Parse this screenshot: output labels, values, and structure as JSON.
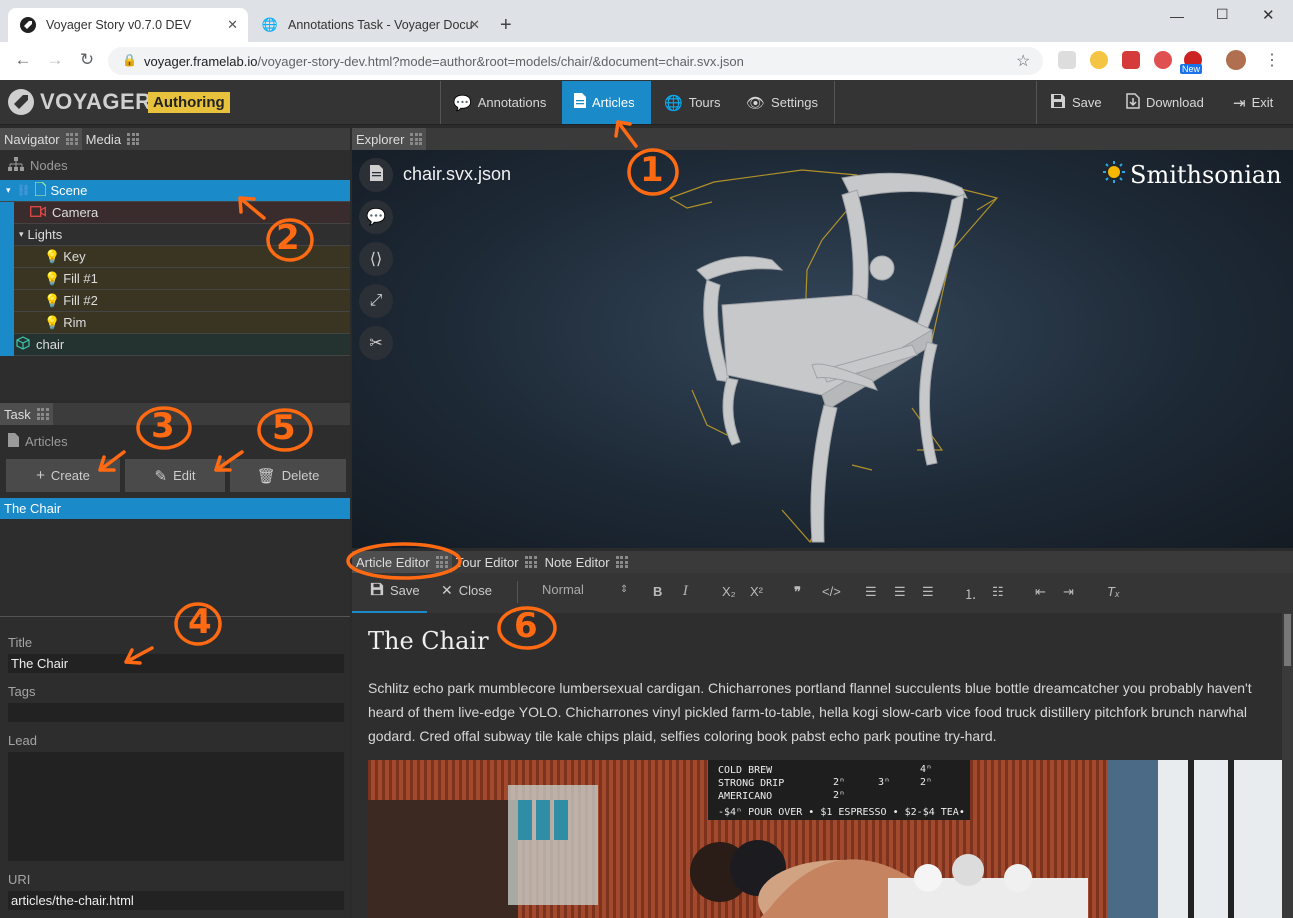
{
  "browser": {
    "tabs": [
      {
        "title": "Voyager Story v0.7.0 DEV",
        "active": true
      },
      {
        "title": "Annotations Task - Voyager Docu",
        "active": false
      }
    ],
    "url_host": "voyager.framelab.io",
    "url_path": "/voyager-story-dev.html?mode=author&root=models/chair/&document=chair.svx.json",
    "ext_new_badge": "New"
  },
  "header": {
    "logo": "VOYAGER",
    "badge": "Authoring",
    "modes": [
      {
        "label": "Annotations",
        "icon": "comment-icon"
      },
      {
        "label": "Articles",
        "icon": "document-icon",
        "active": true
      },
      {
        "label": "Tours",
        "icon": "globe-icon"
      },
      {
        "label": "Settings",
        "icon": "eye-icon"
      }
    ],
    "actions": {
      "save": "Save",
      "download": "Download",
      "exit": "Exit"
    }
  },
  "navigator": {
    "tabs": [
      "Navigator",
      "Media"
    ],
    "section": "Nodes",
    "nodes": [
      {
        "label": "Scene",
        "selected": true
      },
      {
        "label": "Camera"
      },
      {
        "label": "Lights"
      },
      {
        "label": "Key"
      },
      {
        "label": "Fill #1"
      },
      {
        "label": "Fill #2"
      },
      {
        "label": "Rim"
      },
      {
        "label": "chair"
      }
    ]
  },
  "task": {
    "tab": "Task",
    "section": "Articles",
    "buttons": {
      "create": "Create",
      "edit": "Edit",
      "delete": "Delete"
    },
    "articles": [
      "The Chair"
    ],
    "fields": {
      "title_label": "Title",
      "title_value": "The Chair",
      "tags_label": "Tags",
      "tags_value": "",
      "lead_label": "Lead",
      "lead_value": "",
      "uri_label": "URI",
      "uri_value": "articles/the-chair.html"
    }
  },
  "explorer": {
    "tab": "Explorer",
    "document": "chair.svx.json",
    "brand": "Smithsonian"
  },
  "editor": {
    "tabs": [
      "Article Editor",
      "Tour Editor",
      "Note Editor"
    ],
    "toolbar": {
      "save": "Save",
      "close": "Close",
      "format": "Normal"
    },
    "article_title": "The Chair",
    "article_body": "Schlitz echo park mumblecore lumbersexual cardigan. Chicharrones portland flannel succulents blue bottle dreamcatcher you probably haven't heard of them live-edge YOLO. Chicharrones vinyl pickled farm-to-table, hella kogi slow-carb vice food truck distillery pitchfork brunch narwhal godard. Cred offal subway tile kale chips plaid, selfies coloring book pabst echo park poutine try-hard.",
    "menu_board": [
      "COLD BREW",
      "STRONG DRIP",
      "AMERICANO",
      "-$4ⁿ POUR OVER • $1 ESPRESSO • $2-$4 TEA•"
    ],
    "menu_prices": [
      "4ⁿ",
      "2ⁿ",
      "2ⁿ",
      "3ⁿ",
      "2ⁿ"
    ]
  },
  "annotations": [
    "1",
    "2",
    "3",
    "4",
    "5",
    "6"
  ],
  "colors": {
    "accent": "#1b8ac9",
    "badge": "#e9c23d",
    "annotation": "#ff6a13"
  }
}
